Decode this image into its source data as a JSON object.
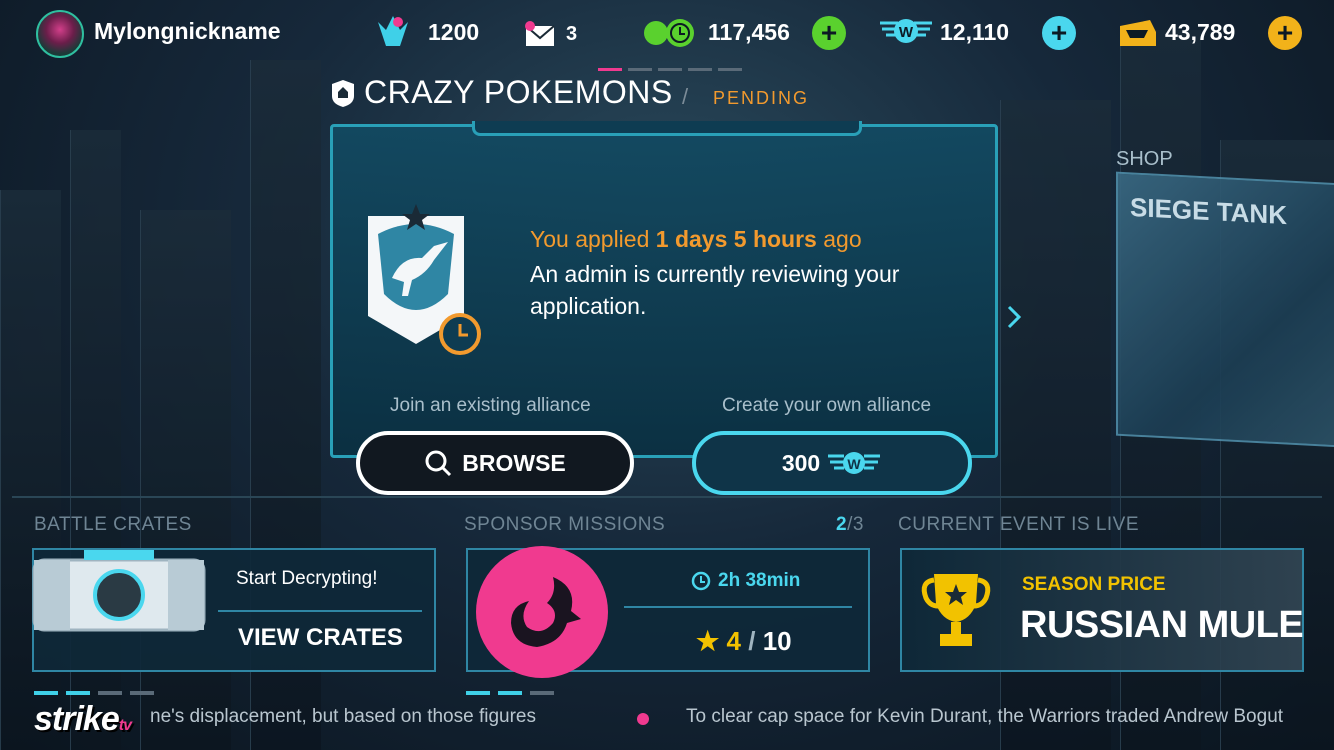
{
  "user": {
    "nickname": "Mylongnickname"
  },
  "resources": {
    "trophies": "1200",
    "mail": "3",
    "cash": "117,456",
    "wings": "12,110",
    "supplies": "43,789",
    "plus": "+"
  },
  "alliance": {
    "name": "CRAZY POKEMONS",
    "separator": "/",
    "status": "PENDING",
    "applied_prefix": "You applied ",
    "applied_time": "1 days 5 hours",
    "applied_suffix": " ago",
    "review_text": "An admin is currently reviewing your application.",
    "join_label": "Join an existing alliance",
    "create_label": "Create your own alliance",
    "browse_button": "BROWSE",
    "create_cost": "300"
  },
  "shop": {
    "label": "SHOP",
    "card_title": "SIEGE TANK"
  },
  "battle_crates": {
    "label": "BATTLE CRATES",
    "subtitle": "Start Decrypting!",
    "button": "VIEW CRATES"
  },
  "sponsor_missions": {
    "label": "SPONSOR MISSIONS",
    "page_current": "2",
    "page_total": "/3",
    "timer": "2h 38min",
    "stars_done": "4",
    "stars_sep": "/",
    "stars_total": "10"
  },
  "event": {
    "label": "CURRENT EVENT IS LIVE",
    "subtitle": "SEASON PRICE",
    "name": "RUSSIAN MULE"
  },
  "ticker": {
    "logo": "strike",
    "logo_suffix": "tv",
    "item1": "ne's displacement, but based on those figures",
    "item2": "To clear cap space for Kevin Durant, the Warriors traded Andrew Bogut"
  },
  "colors": {
    "accent": "#4ad7ee",
    "orange": "#f29a2e",
    "pink": "#f03a8f",
    "green": "#5ad12e",
    "gold": "#f2c200"
  }
}
